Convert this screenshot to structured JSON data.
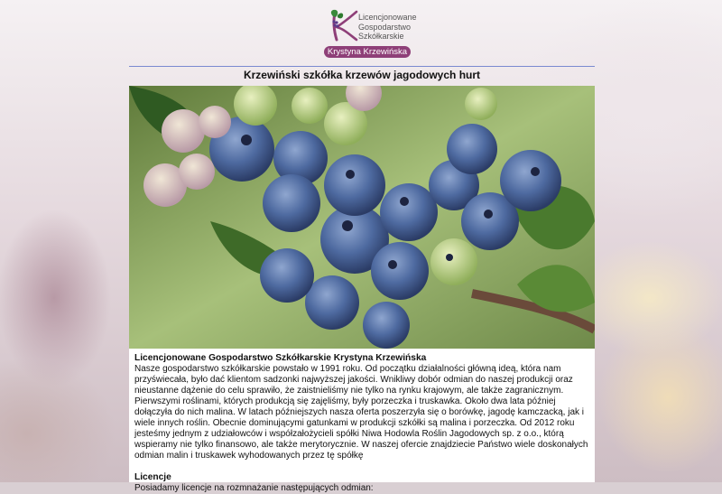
{
  "logo": {
    "line1": "Licencjonowane",
    "line2": "Gospodarstwo",
    "line3": "Szkółkarskie",
    "owner": "Krystyna Krzewińska"
  },
  "page_title": "Krzewiński szkółka krzewów jagodowych hurt",
  "hero_image": "blueberries-photo",
  "about": {
    "heading": "Licencjonowane Gospodarstwo Szkółkarskie Krystyna Krzewińska",
    "body": "Nasze gospodarstwo szkółkarskie powstało w 1991 roku. Od początku działalności główną ideą, która nam przyświecała, było dać klientom sadzonki najwyższej jakości. Wnikliwy dobór odmian do naszej produkcji oraz nieustanne dążenie do celu sprawiło, że zaistnieliśmy nie tylko na rynku krajowym, ale także zagranicznym. Pierwszymi roślinami, których produkcją się zajęliśmy, były porzeczka i truskawka. Około dwa lata później dołączyła do nich malina. W latach późniejszych nasza oferta poszerzyła się o borówkę, jagodę kamczacką, jak i wiele innych roślin. Obecnie dominującymi gatunkami w produkcji szkółki są malina i porzeczka. Od 2012 roku jesteśmy jednym z udziałowców i współzałożycieli spółki Niwa Hodowla Roślin Jagodowych sp. z o.o., którą wspieramy nie tylko finansowo, ale także merytorycznie. W naszej ofercie znajdziecie Państwo wiele doskonałych odmian malin i truskawek wyhodowanych przez tę spółkę"
  },
  "licenses": {
    "heading": "Licencje",
    "body": "Posiadamy licencje na rozmnażanie następujących odmian:"
  },
  "colors": {
    "brand": "#8e3f78",
    "rule": "#7a8ad0"
  }
}
